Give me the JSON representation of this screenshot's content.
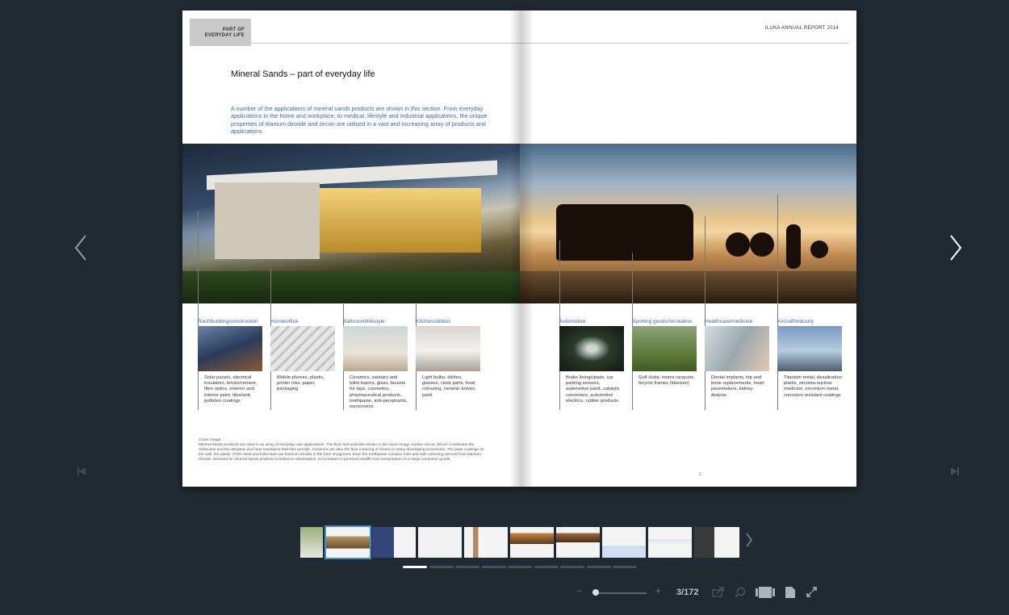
{
  "book": {
    "tab_label_line1": "PART OF",
    "tab_label_line2": "EVERYDAY LIFE",
    "report_title": "ILUKA ANNUAL REPORT 2014",
    "headline": "Mineral Sands – part of everyday life",
    "intro": "A number of the applications of mineral sands products are shown in this section. From everyday applications in the home and workplace, to medical, lifestyle and industrial applications, the unique properties of titanium dioxide and zircon are utilised in a vast and increasing array of products and applications.",
    "categories": [
      {
        "title": "Roof/building/construction",
        "desc": "Solar panels, electrical insulators, bricks/cement, fibre optics, exterior and interior paint, tiles/anti-pollution coatings"
      },
      {
        "title": "Home/office",
        "desc": "Mobile phones, plastic, printer inks, paper, packaging"
      },
      {
        "title": "Bathroom/lifestyle",
        "desc": "Ceramics, sanitary and toilet basins, glass, faucets for taps, cosmetics, pharmaceutical products, toothpaste, anti-perspirants, sunscreens"
      },
      {
        "title": "Kitchen/utilities",
        "desc": "Light bulbs, dishes, glasses, clock parts, food colouring, ceramic knives, paint"
      },
      {
        "title": "Automotive",
        "desc": "Brake linings/pads, car parking sensors, automotive paint, catalytic converters, automotive electrics, rubber products"
      },
      {
        "title": "Sporting goods/recreation",
        "desc": "Golf clubs, tennis racquets, bicycle frames (titanium)"
      },
      {
        "title": "Healthcare/medicine",
        "desc": "Dental implants, hip and bone replacements, heart pacemakers, kidney dialysis"
      },
      {
        "title": "Aircraft/industry",
        "desc": "Titanium metal, desalination plants, zirconia-nuclear medicine, zirconium metal, corrosion resistant coatings"
      }
    ],
    "cover_note_title": "Cover Image:",
    "cover_note": "Mineral sands products are used in an array of everyday use applications. The floor and wall tiles shown in the cover image contain zircon. Zircon contributes the whiteness and the abrasion and heat resistance that tiles provide. Ceramics are also the floor covering of choice in many developing economies. The paint coatings on the wall, the plastic of the stool and toilet seat use titanium dioxide in the form of pigment. Even the toothpaste contains inert and safe colouring derived from titanium dioxide. Demand for mineral sands products is linked to urbanisation, to increases in personal wealth and consumption of a range consumer goods.",
    "page_number": "1"
  },
  "navigation": {
    "prev_icon": "chevron-left-icon",
    "next_icon": "chevron-right-icon",
    "first_icon": "skip-first-icon",
    "last_icon": "skip-last-icon"
  },
  "toolbar": {
    "zoom_out": "−",
    "zoom_in": "+",
    "page_indicator": "3/172",
    "zoom_level": 0
  },
  "thumbnail_count": 10,
  "active_thumbnail": 2,
  "pager_count": 9,
  "active_pager": 1,
  "colors": {
    "background": "#1f2a33",
    "accent_blue": "#3a69a8",
    "active_outline": "#3e8ed0"
  }
}
